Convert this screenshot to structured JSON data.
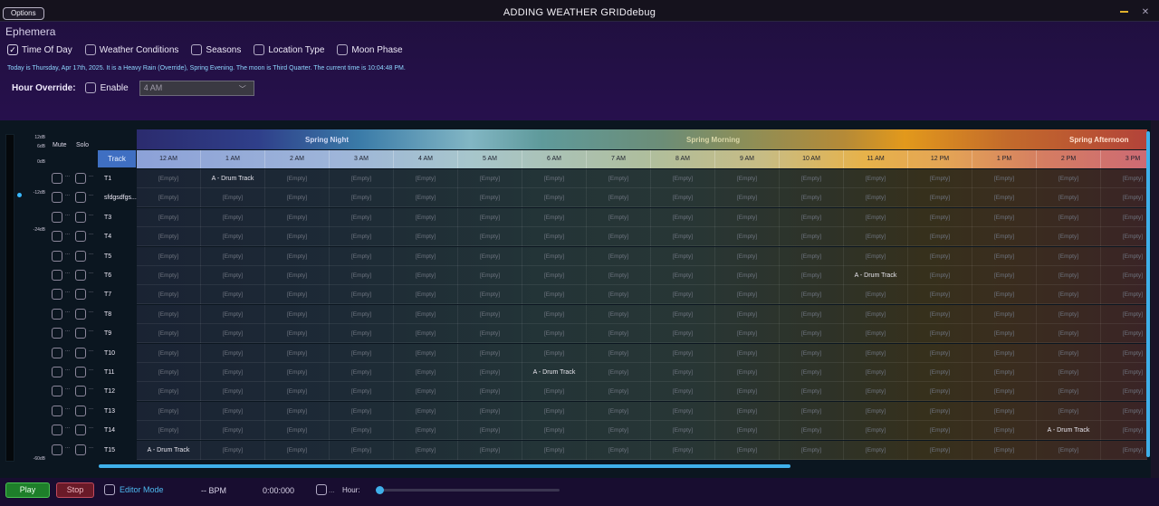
{
  "window": {
    "title": "ADDING WEATHER GRIDdebug",
    "options_label": "Options"
  },
  "app": {
    "name": "Ephemera"
  },
  "filters": [
    {
      "label": "Time Of Day",
      "checked": true
    },
    {
      "label": "Weather Conditions",
      "checked": false
    },
    {
      "label": "Seasons",
      "checked": false
    },
    {
      "label": "Location Type",
      "checked": false
    },
    {
      "label": "Moon Phase",
      "checked": false
    }
  ],
  "status": "Today is Thursday, Apr 17th, 2025. It is a Heavy Rain (Override), Spring Evening. The moon is Third Quarter. The current time is 10:04:48 PM.",
  "hour_override": {
    "label": "Hour Override:",
    "enable_label": "Enable",
    "enabled": false,
    "selected": "4 AM"
  },
  "meter": {
    "db_labels": [
      "12dB",
      "6dB",
      "0dB",
      "-12dB",
      "-24dB",
      "-60dB"
    ]
  },
  "grid": {
    "mute_label": "Mute",
    "solo_label": "Solo",
    "track_header": "Track",
    "seasons": [
      {
        "label": "Spring Night",
        "color": "#d5dcf5"
      },
      {
        "label": "Spring Morning",
        "color": "#d9d7a8"
      },
      {
        "label": "Spring Afternoon",
        "color": "#ffe1cf"
      }
    ],
    "hours": [
      "12 AM",
      "1 AM",
      "2 AM",
      "3 AM",
      "4 AM",
      "5 AM",
      "6 AM",
      "7 AM",
      "8 AM",
      "9 AM",
      "10 AM",
      "11 AM",
      "12 PM",
      "1 PM",
      "2 PM",
      "3 PM"
    ],
    "empty_label": "[Empty]",
    "tracks": [
      {
        "name": "T1",
        "clips": {
          "1": "A - Drum Track"
        }
      },
      {
        "name": "sfdgsdfgs...",
        "clips": {}
      },
      {
        "name": "T3",
        "clips": {}
      },
      {
        "name": "T4",
        "clips": {}
      },
      {
        "name": "T5",
        "clips": {}
      },
      {
        "name": "T6",
        "clips": {
          "11": "A - Drum Track"
        }
      },
      {
        "name": "T7",
        "clips": {}
      },
      {
        "name": "T8",
        "clips": {}
      },
      {
        "name": "T9",
        "clips": {}
      },
      {
        "name": "T10",
        "clips": {}
      },
      {
        "name": "T11",
        "clips": {
          "6": "A - Drum Track"
        }
      },
      {
        "name": "T12",
        "clips": {}
      },
      {
        "name": "T13",
        "clips": {}
      },
      {
        "name": "T14",
        "clips": {
          "14": "A - Drum Track"
        }
      },
      {
        "name": "T15",
        "clips": {
          "0": "A - Drum Track"
        }
      }
    ],
    "row_dots": "..."
  },
  "transport": {
    "play_label": "Play",
    "stop_label": "Stop",
    "editor_mode_label": "Editor Mode",
    "editor_mode_checked": false,
    "bpm": "-- BPM",
    "time": "0:00:000",
    "loop_dots": "...",
    "hour_label": "Hour:",
    "hour_slider_value": 0
  }
}
